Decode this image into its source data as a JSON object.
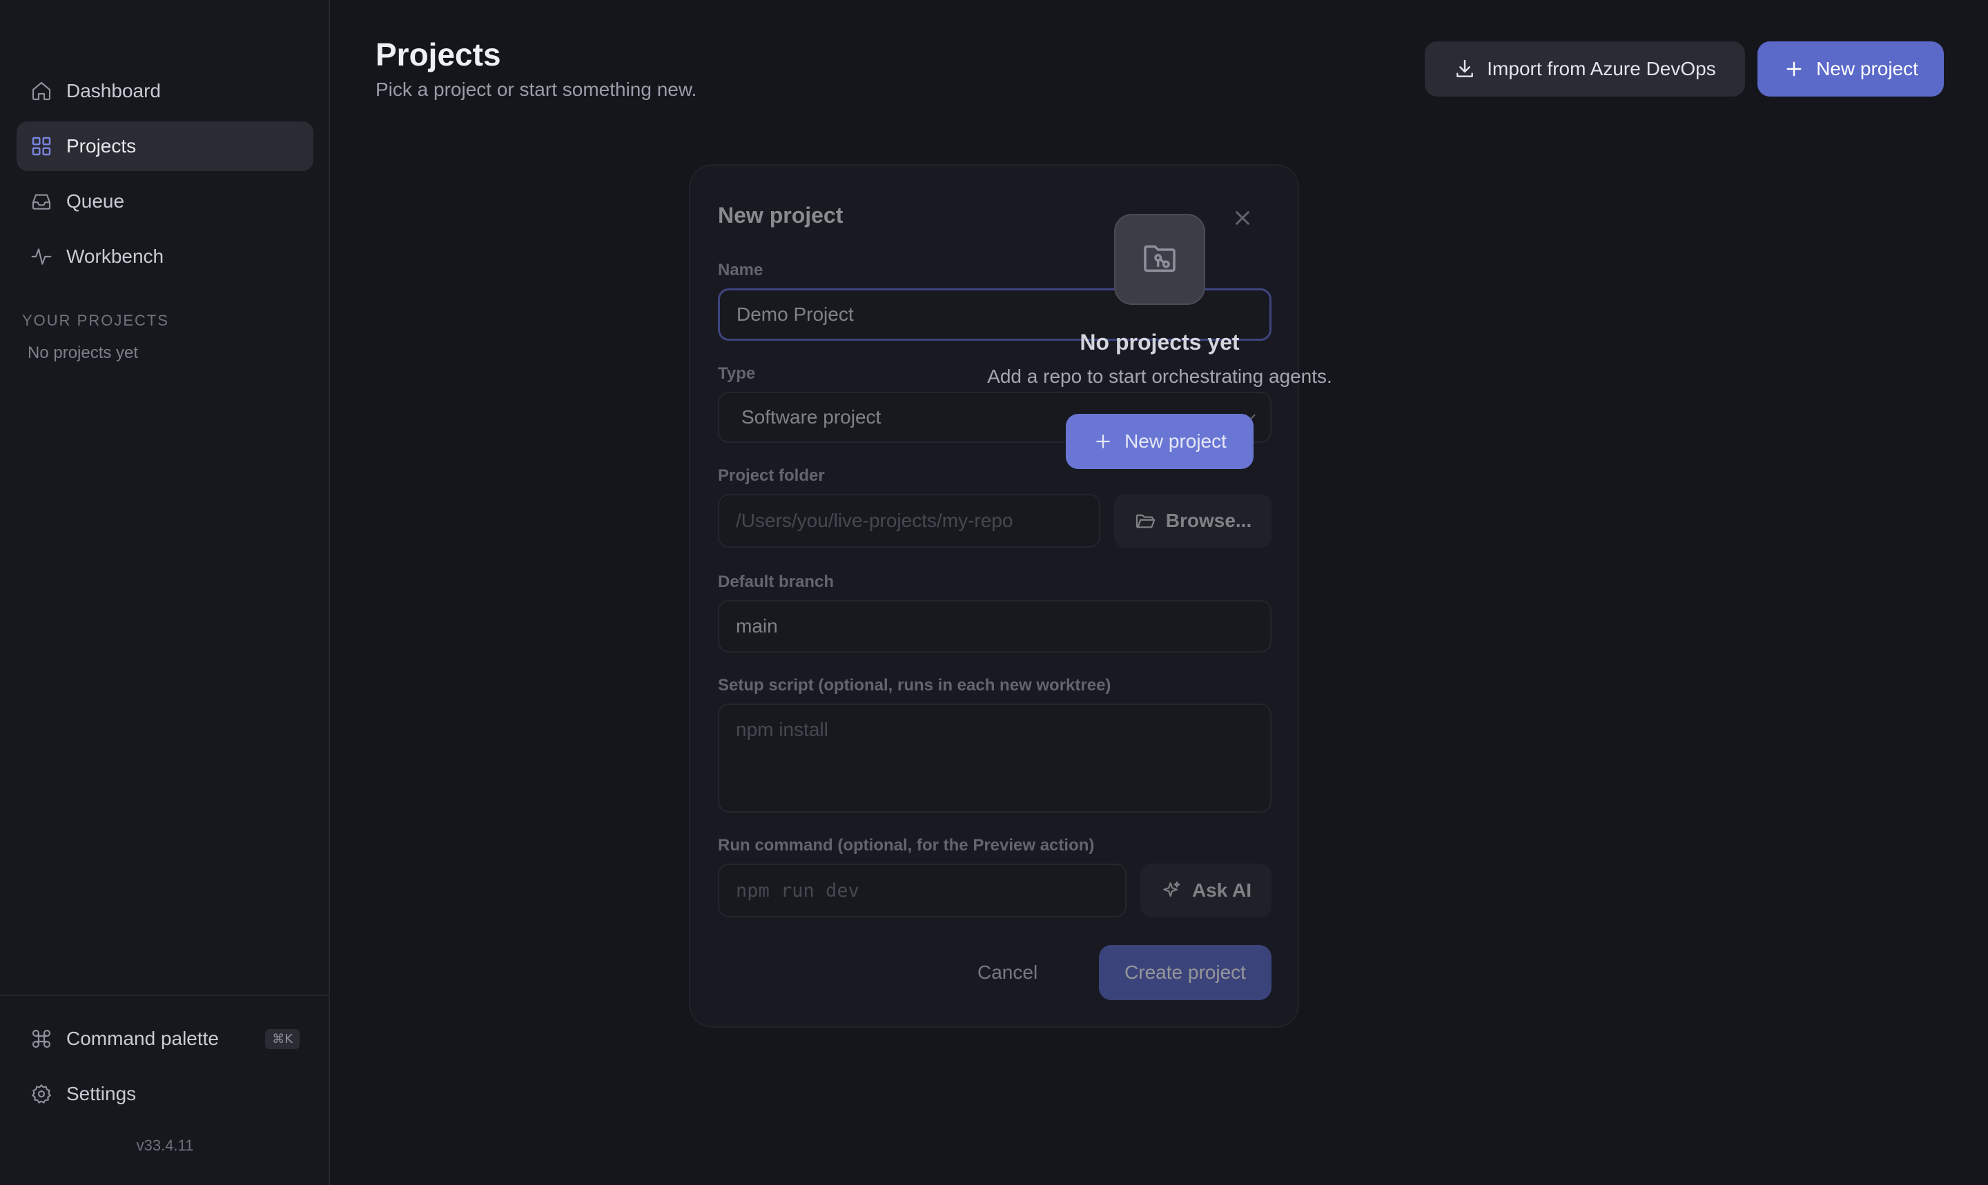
{
  "sidebar": {
    "nav": [
      {
        "label": "Dashboard",
        "icon": "home-icon"
      },
      {
        "label": "Projects",
        "icon": "grid-icon"
      },
      {
        "label": "Queue",
        "icon": "inbox-icon"
      },
      {
        "label": "Workbench",
        "icon": "activity-icon"
      }
    ],
    "section_heading": "YOUR PROJECTS",
    "empty_text": "No projects yet",
    "command_palette": {
      "label": "Command palette",
      "shortcut": "⌘K"
    },
    "settings_label": "Settings",
    "version": "v33.4.11"
  },
  "header": {
    "title": "Projects",
    "subtitle": "Pick a project or start something new.",
    "import_label": "Import from Azure DevOps",
    "new_project_label": "New project"
  },
  "empty_state": {
    "title": "No projects yet",
    "subtitle": "Add a repo to start orchestrating agents.",
    "button_label": "New project"
  },
  "modal": {
    "title": "New project",
    "name_label": "Name",
    "name_value": "Demo Project",
    "type_label": "Type",
    "type_value": "Software project",
    "folder_label": "Project folder",
    "folder_placeholder": "/Users/you/live-projects/my-repo",
    "browse_label": "Browse...",
    "branch_label": "Default branch",
    "branch_value": "main",
    "setup_label": "Setup script (optional, runs in each new worktree)",
    "setup_placeholder": "npm install",
    "run_label": "Run command (optional, for the Preview action)",
    "run_placeholder": "npm run dev",
    "ask_ai_label": "Ask AI",
    "cancel_label": "Cancel",
    "create_label": "Create project"
  },
  "colors": {
    "background": "#15161c",
    "sidebar": "#17181e",
    "accent": "#5b69c9",
    "active_item": "#2a2b33"
  }
}
